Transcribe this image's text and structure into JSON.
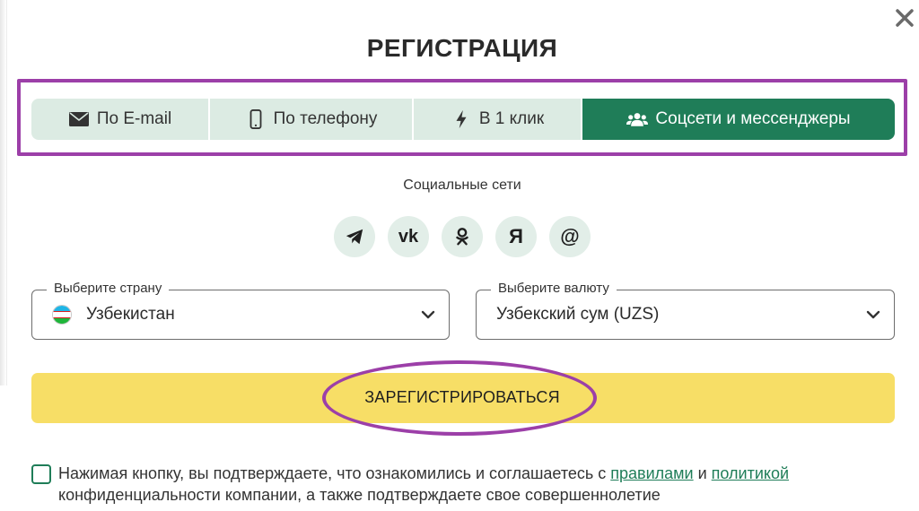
{
  "title": "РЕГИСТРАЦИЯ",
  "tabs": [
    {
      "label": "По E-mail",
      "icon": "envelope-icon"
    },
    {
      "label": "По телефону",
      "icon": "phone-icon"
    },
    {
      "label": "В 1 клик",
      "icon": "lightning-icon"
    },
    {
      "label": "Соцсети и мессенджеры",
      "icon": "users-icon",
      "active": true
    }
  ],
  "social": {
    "label": "Социальные сети",
    "networks": [
      {
        "name": "telegram",
        "glyph": ""
      },
      {
        "name": "vk",
        "glyph": "vk"
      },
      {
        "name": "odnoklassniki",
        "glyph": ""
      },
      {
        "name": "yandex",
        "glyph": "Я"
      },
      {
        "name": "mail",
        "glyph": "@"
      }
    ]
  },
  "country": {
    "legend": "Выберите страну",
    "value": "Узбекистан"
  },
  "currency": {
    "legend": "Выберите валюту",
    "value": "Узбекский сум (UZS)"
  },
  "submit": {
    "label": "ЗАРЕГИСТРИРОВАТЬСЯ"
  },
  "agreement": {
    "text_before": "Нажимая кнопку, вы подтверждаете, что ознакомились и соглашаетесь с ",
    "link_rules": "правилами",
    "and": " и ",
    "link_policy": "политикой",
    "text_after": " конфиденциальности компании, а также подтверждаете свое совершеннолетие"
  },
  "colors": {
    "accent": "#1f7d58",
    "tab_bg": "#dcebe3",
    "button": "#f7de66",
    "highlight": "#9c3fa8"
  }
}
